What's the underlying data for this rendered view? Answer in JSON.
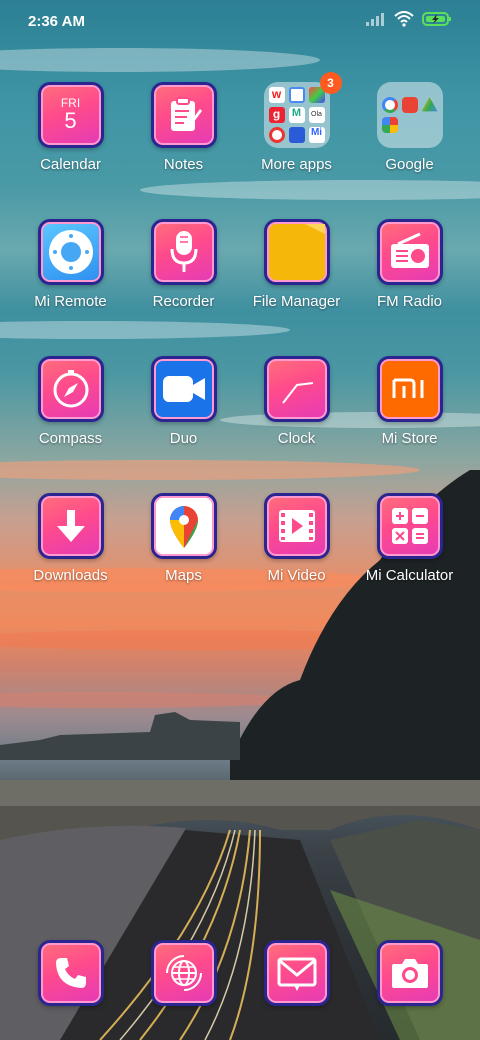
{
  "status": {
    "time": "2:36 AM",
    "signal_icon": "signal-icon",
    "wifi_icon": "wifi-icon",
    "battery_icon": "battery-charging-icon"
  },
  "apps": [
    {
      "label": "Calendar",
      "icon": "calendar-icon",
      "day": "FRI",
      "date": "5"
    },
    {
      "label": "Notes",
      "icon": "notes-icon"
    },
    {
      "label": "More apps",
      "icon": "folder-icon",
      "badge": "3"
    },
    {
      "label": "Google",
      "icon": "folder-icon"
    },
    {
      "label": "Mi Remote",
      "icon": "remote-icon"
    },
    {
      "label": "Recorder",
      "icon": "microphone-icon"
    },
    {
      "label": "File Manager",
      "icon": "file-folder-icon"
    },
    {
      "label": "FM Radio",
      "icon": "radio-icon"
    },
    {
      "label": "Compass",
      "icon": "compass-icon"
    },
    {
      "label": "Duo",
      "icon": "video-camera-icon"
    },
    {
      "label": "Clock",
      "icon": "clock-icon"
    },
    {
      "label": "Mi Store",
      "icon": "mi-logo-icon"
    },
    {
      "label": "Downloads",
      "icon": "download-arrow-icon"
    },
    {
      "label": "Maps",
      "icon": "maps-pin-icon"
    },
    {
      "label": "Mi Video",
      "icon": "film-play-icon"
    },
    {
      "label": "Mi Calculator",
      "icon": "calculator-icon"
    }
  ],
  "dock": [
    {
      "icon": "phone-icon"
    },
    {
      "icon": "browser-globe-icon"
    },
    {
      "icon": "messages-icon"
    },
    {
      "icon": "camera-icon"
    }
  ],
  "colors": {
    "tile_gradient_start": "#ff6f7a",
    "tile_gradient_end": "#e43bb8",
    "tile_border": "#2a2590",
    "badge": "#ff5a1f"
  }
}
